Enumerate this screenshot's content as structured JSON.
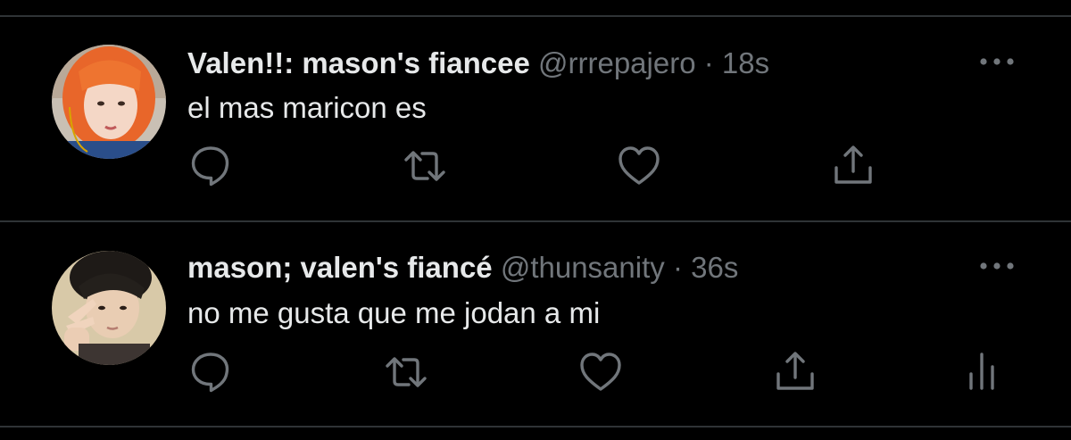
{
  "tweets": [
    {
      "display_name": "Valen!!: mason's fiancee",
      "handle": "@rrrepajero",
      "separator": "·",
      "time": "18s",
      "text": "el mas maricon es",
      "avatar_icon": "avatar-orange-hair",
      "actions": [
        "reply-icon",
        "retweet-icon",
        "like-icon",
        "share-icon"
      ]
    },
    {
      "display_name": "mason; valen's fiancé",
      "handle": "@thunsanity",
      "separator": "·",
      "time": "36s",
      "text": "no me gusta que me jodan a mi",
      "avatar_icon": "avatar-peace-sign",
      "actions": [
        "reply-icon",
        "retweet-icon",
        "like-icon",
        "share-icon",
        "analytics-icon"
      ]
    }
  ],
  "colors": {
    "background": "#000000",
    "text_primary": "#e7e9ea",
    "text_secondary": "#71767b",
    "divider": "#2f3336",
    "icon": "#71767b"
  }
}
